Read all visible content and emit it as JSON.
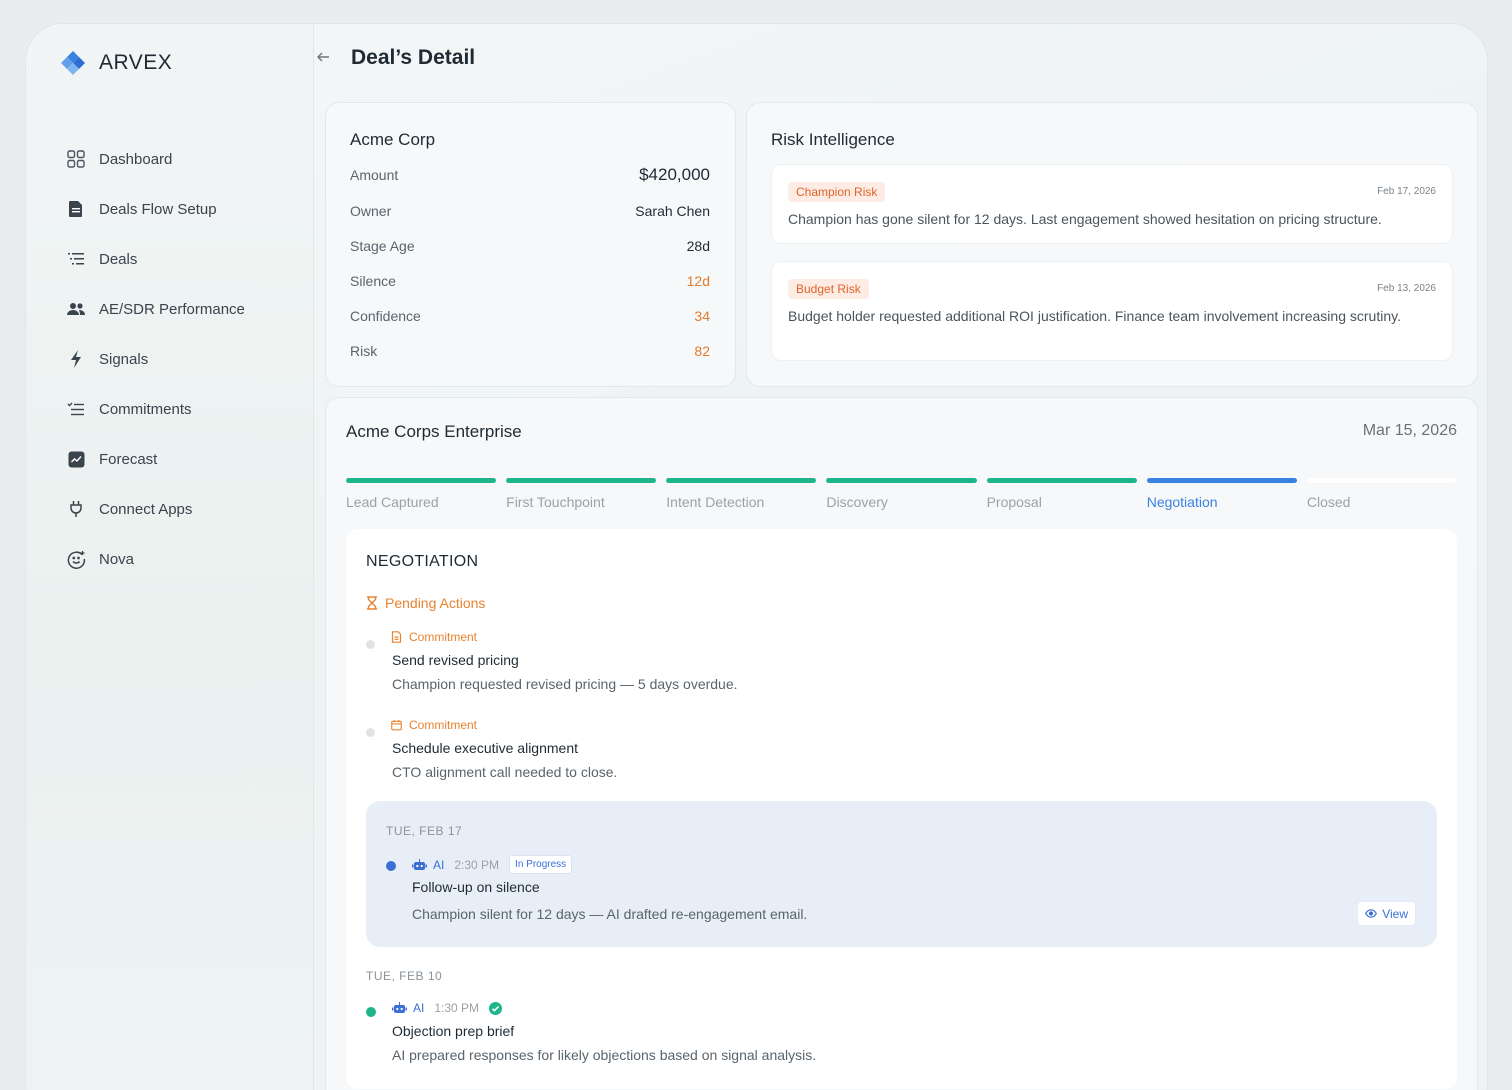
{
  "app": {
    "name": "ARVEX"
  },
  "sidebar": {
    "items": [
      {
        "label": "Dashboard",
        "icon": "grid-icon"
      },
      {
        "label": "Deals Flow Setup",
        "icon": "document-icon"
      },
      {
        "label": "Deals",
        "icon": "list-icon"
      },
      {
        "label": "AE/SDR Performance",
        "icon": "people-icon"
      },
      {
        "label": "Signals",
        "icon": "bolt-icon"
      },
      {
        "label": "Commitments",
        "icon": "checklist-icon"
      },
      {
        "label": "Forecast",
        "icon": "chart-icon"
      },
      {
        "label": "Connect Apps",
        "icon": "plug-icon"
      },
      {
        "label": "Nova",
        "icon": "smiley-icon"
      }
    ]
  },
  "header": {
    "title": "Deal’s Detail"
  },
  "deal": {
    "company": "Acme Corp",
    "rows": [
      {
        "label": "Amount",
        "value": "$420,000"
      },
      {
        "label": "Owner",
        "value": "Sarah Chen"
      },
      {
        "label": "Stage Age",
        "value": "28d"
      },
      {
        "label": "Silence",
        "value": "12d"
      },
      {
        "label": "Confidence",
        "value": "34"
      },
      {
        "label": "Risk",
        "value": "82"
      }
    ]
  },
  "risk": {
    "title": "Risk Intelligence",
    "items": [
      {
        "badge": "Champion Risk",
        "date": "Feb 17, 2026",
        "text": "Champion has gone silent for 12 days. Last engagement showed hesitation on pricing structure."
      },
      {
        "badge": "Budget Risk",
        "date": "Feb 13, 2026",
        "text": "Budget holder requested additional ROI justification. Finance team involvement increasing scrutiny."
      }
    ]
  },
  "pipeline": {
    "title": "Acme Corps Enterprise",
    "date": "Mar 15, 2026",
    "stages": [
      {
        "label": "Lead Captured",
        "state": "done"
      },
      {
        "label": "First Touchpoint",
        "state": "done"
      },
      {
        "label": "Intent Detection",
        "state": "done"
      },
      {
        "label": "Discovery",
        "state": "done"
      },
      {
        "label": "Proposal",
        "state": "done"
      },
      {
        "label": "Negotiation",
        "state": "active"
      },
      {
        "label": "Closed",
        "state": "todo"
      }
    ]
  },
  "negotiation": {
    "title": "NEGOTIATION",
    "pending_label": "Pending Actions",
    "actions": [
      {
        "tag": "Commitment",
        "title": "Send revised pricing",
        "desc": "Champion requested revised pricing — 5 days overdue."
      },
      {
        "tag": "Commitment",
        "title": "Schedule executive alignment",
        "desc": "CTO alignment call needed to close."
      }
    ],
    "timeline": [
      {
        "day": "TUE, FEB 17",
        "source": "AI",
        "time": "2:30 PM",
        "status": "In Progress",
        "title": "Follow-up on silence",
        "desc": "Champion silent for 12 days — AI drafted re-engagement email.",
        "action": "View"
      },
      {
        "day": "TUE, FEB 10",
        "source": "AI",
        "time": "1:30 PM",
        "title": "Objection prep brief",
        "desc": "AI prepared responses for likely objections based on signal analysis."
      }
    ]
  },
  "colors": {
    "accent_blue": "#3b82e0",
    "success_green": "#1fb58a",
    "warning_orange": "#e8832f"
  }
}
